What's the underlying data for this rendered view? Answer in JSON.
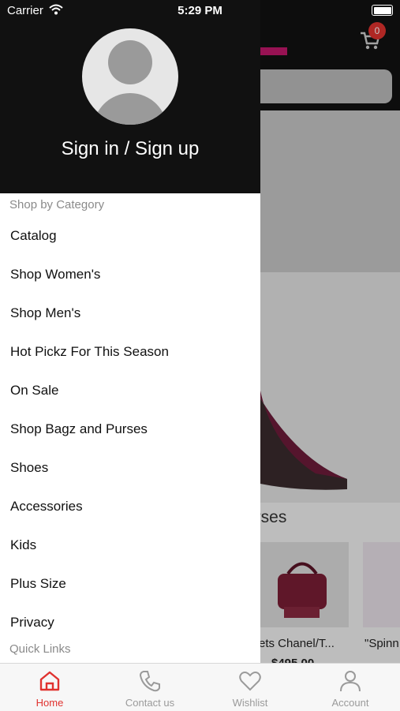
{
  "status_bar": {
    "carrier": "Carrier",
    "time": "5:29 PM"
  },
  "background": {
    "cart_count": "0",
    "section_title": "urses",
    "product1_title": "Sets Chanel/T...",
    "product2_title": "\"Spinn",
    "product1_price": "$495.00"
  },
  "drawer": {
    "signin_label": "Sign in / Sign up",
    "shop_by_category": "Shop by Category",
    "items": [
      {
        "label": "Catalog"
      },
      {
        "label": "Shop Women's"
      },
      {
        "label": "Shop Men's"
      },
      {
        "label": "Hot Pickz For This Season"
      },
      {
        "label": "On Sale"
      },
      {
        "label": "Shop Bagz and Purses"
      },
      {
        "label": "Shoes"
      },
      {
        "label": "Accessories"
      },
      {
        "label": "Kids"
      },
      {
        "label": "Plus Size"
      },
      {
        "label": "Privacy"
      }
    ],
    "quick_links": "Quick Links"
  },
  "tabbar": {
    "tabs": [
      {
        "label": "Home",
        "icon": "home-icon",
        "active": true
      },
      {
        "label": "Contact us",
        "icon": "phone-icon",
        "active": false
      },
      {
        "label": "Wishlist",
        "icon": "heart-icon",
        "active": false
      },
      {
        "label": "Account",
        "icon": "person-icon",
        "active": false
      }
    ]
  },
  "colors": {
    "accent": "#e0322f",
    "header_bg": "#111111",
    "brand": "#c2186b"
  }
}
